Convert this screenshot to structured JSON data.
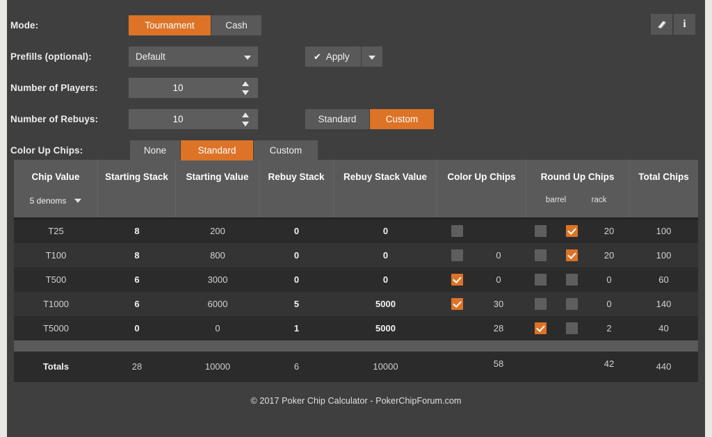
{
  "form": {
    "mode": {
      "label": "Mode:",
      "options": [
        "Tournament",
        "Cash"
      ],
      "selected": "Tournament"
    },
    "prefills": {
      "label": "Prefills (optional):",
      "value": "Default",
      "apply_label": "Apply"
    },
    "players": {
      "label": "Number of Players:",
      "value": "10"
    },
    "rebuys": {
      "label": "Number of Rebuys:",
      "value": "10",
      "options": [
        "Standard",
        "Custom"
      ],
      "selected": "Custom"
    },
    "colorup": {
      "label": "Color Up Chips:",
      "options": [
        "None",
        "Standard",
        "Custom"
      ],
      "selected": "Standard"
    }
  },
  "toolbar": {
    "manual_icon": "book-icon",
    "info_icon": "info-icon",
    "info_glyph": "i"
  },
  "table": {
    "headers": {
      "chip_value": "Chip Value",
      "denoms": "5 denoms",
      "starting_stack": "Starting Stack",
      "starting_value": "Starting Value",
      "rebuy_stack": "Rebuy Stack",
      "rebuy_stack_value": "Rebuy Stack Value",
      "color_up_chips": "Color Up Chips",
      "round_up_chips": "Round Up Chips",
      "round_sub_barrel": "barrel",
      "round_sub_rack": "rack",
      "total_chips": "Total Chips"
    },
    "rows": [
      {
        "chip_value": "T25",
        "starting_stack": "8",
        "starting_value": "200",
        "rebuy_stack": "0",
        "rebuy_stack_value": "0",
        "color_up_checked": false,
        "color_up_value": "",
        "round_barrel_checked": false,
        "round_barrel_visible": true,
        "round_rack_checked": true,
        "round_rack_visible": true,
        "round_value": "20",
        "total_chips": "100"
      },
      {
        "chip_value": "T100",
        "starting_stack": "8",
        "starting_value": "800",
        "rebuy_stack": "0",
        "rebuy_stack_value": "0",
        "color_up_checked": false,
        "color_up_value": "0",
        "round_barrel_checked": false,
        "round_barrel_visible": true,
        "round_rack_checked": true,
        "round_rack_visible": true,
        "round_value": "20",
        "total_chips": "100"
      },
      {
        "chip_value": "T500",
        "starting_stack": "6",
        "starting_value": "3000",
        "rebuy_stack": "0",
        "rebuy_stack_value": "0",
        "color_up_checked": true,
        "color_up_value": "0",
        "round_barrel_checked": false,
        "round_barrel_visible": true,
        "round_rack_checked": false,
        "round_rack_visible": true,
        "round_value": "0",
        "total_chips": "60"
      },
      {
        "chip_value": "T1000",
        "starting_stack": "6",
        "starting_value": "6000",
        "rebuy_stack": "5",
        "rebuy_stack_value": "5000",
        "color_up_checked": true,
        "color_up_value": "30",
        "round_barrel_checked": false,
        "round_barrel_visible": true,
        "round_rack_checked": false,
        "round_rack_visible": true,
        "round_value": "0",
        "total_chips": "140"
      },
      {
        "chip_value": "T5000",
        "starting_stack": "0",
        "starting_value": "0",
        "rebuy_stack": "1",
        "rebuy_stack_value": "5000",
        "color_up_checked": false,
        "color_up_checkbox_visible": false,
        "color_up_value": "28",
        "round_barrel_checked": true,
        "round_barrel_visible": true,
        "round_rack_checked": false,
        "round_rack_visible": true,
        "round_value": "2",
        "total_chips": "40"
      }
    ],
    "totals": {
      "label": "Totals",
      "starting_stack": "28",
      "starting_value": "10000",
      "rebuy_stack": "6",
      "rebuy_stack_value": "10000",
      "color_up": "58",
      "round_up": "42",
      "total_chips": "440"
    }
  },
  "footer": {
    "text": "© 2017 Poker Chip Calculator - PokerChipForum.com"
  },
  "colors": {
    "accent": "#dd7327",
    "panel": "#3f3f3f",
    "control": "#595959",
    "row_odd": "#2b2b2b",
    "row_even": "#343434",
    "header": "#5a5a5a"
  }
}
